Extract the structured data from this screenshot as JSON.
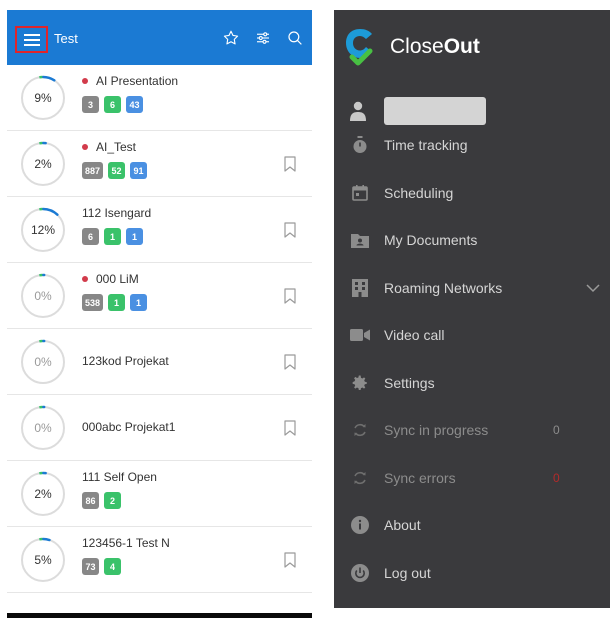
{
  "app_bar": {
    "title": "Test",
    "icons": [
      "menu-icon",
      "star-icon",
      "filter-icon",
      "search-icon"
    ],
    "background": "#1b7ad3"
  },
  "projects": [
    {
      "name": "AI Presentation",
      "progress_percent": 9,
      "progress_label": "9%",
      "flagged": true,
      "badges": [
        {
          "value": "3",
          "color": "gray"
        },
        {
          "value": "6",
          "color": "green"
        },
        {
          "value": "43",
          "color": "blue"
        }
      ],
      "bookmark": false
    },
    {
      "name": "AI_Test",
      "progress_percent": 2,
      "progress_label": "2%",
      "flagged": true,
      "badges": [
        {
          "value": "887",
          "color": "gray"
        },
        {
          "value": "52",
          "color": "green"
        },
        {
          "value": "91",
          "color": "blue"
        }
      ],
      "bookmark": true
    },
    {
      "name": "112 Isengard",
      "progress_percent": 12,
      "progress_label": "12%",
      "flagged": false,
      "badges": [
        {
          "value": "6",
          "color": "gray"
        },
        {
          "value": "1",
          "color": "green"
        },
        {
          "value": "1",
          "color": "blue"
        }
      ],
      "bookmark": true
    },
    {
      "name": "000 LiM",
      "progress_percent": 0,
      "progress_label": "0%",
      "flagged": true,
      "badges": [
        {
          "value": "538",
          "color": "gray"
        },
        {
          "value": "1",
          "color": "green"
        },
        {
          "value": "1",
          "color": "blue"
        }
      ],
      "bookmark": true
    },
    {
      "name": "123kod Projekat",
      "progress_percent": 0,
      "progress_label": "0%",
      "flagged": false,
      "badges": [],
      "bookmark": true
    },
    {
      "name": "000abc Projekat1",
      "progress_percent": 0,
      "progress_label": "0%",
      "flagged": false,
      "badges": [],
      "bookmark": true
    },
    {
      "name": "111 Self Open",
      "progress_percent": 2,
      "progress_label": "2%",
      "flagged": false,
      "badges": [
        {
          "value": "86",
          "color": "gray"
        },
        {
          "value": "2",
          "color": "green"
        }
      ],
      "bookmark": false
    },
    {
      "name": "123456-1 Test N",
      "progress_percent": 5,
      "progress_label": "5%",
      "flagged": false,
      "badges": [
        {
          "value": "73",
          "color": "gray"
        },
        {
          "value": "4",
          "color": "green"
        }
      ],
      "bookmark": true
    }
  ],
  "drawer": {
    "brand_prefix": "Close",
    "brand_suffix": "Out",
    "items": [
      {
        "label": "Time tracking",
        "icon": "stopwatch-icon"
      },
      {
        "label": "Scheduling",
        "icon": "calendar-icon"
      },
      {
        "label": "My Documents",
        "icon": "folder-icon"
      },
      {
        "label": "Roaming Networks",
        "icon": "building-icon",
        "expandable": true
      },
      {
        "label": "Video call",
        "icon": "video-icon"
      },
      {
        "label": "Settings",
        "icon": "gear-icon"
      },
      {
        "label": "Sync in progress",
        "icon": "sync-icon",
        "count": "0",
        "dim": true
      },
      {
        "label": "Sync errors",
        "icon": "sync-icon",
        "count": "0",
        "dim": true,
        "count_color": "red"
      },
      {
        "label": "About",
        "icon": "info-icon"
      },
      {
        "label": "Log out",
        "icon": "power-icon"
      }
    ]
  },
  "colors": {
    "accent": "#1b7ad3",
    "highlight": "#e0242a",
    "drawer_bg": "#3a3a3d",
    "badge_gray": "#878787",
    "badge_green": "#3ac26a",
    "badge_blue": "#4a90e2",
    "flag_dot": "#d23b4b"
  }
}
